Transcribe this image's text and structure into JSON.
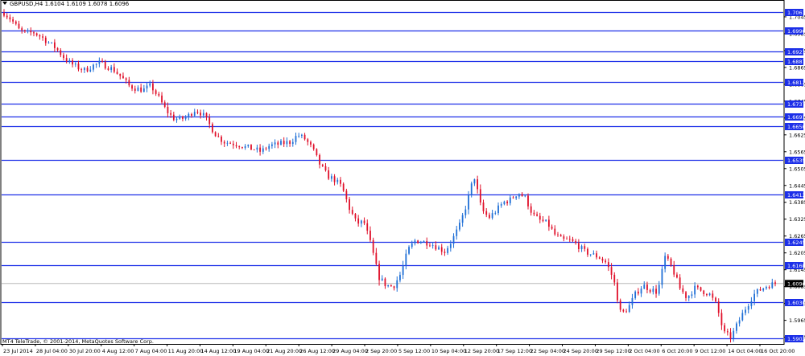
{
  "window": {
    "symbol_line": "GBPUSD,H4  1.6104 1.6109 1.6078 1.6096",
    "copyright": "MT4 TeleTrade, © 2001-2014, MetaQuotes Software Corp."
  },
  "colors": {
    "bull": "#1f6fd6",
    "bear": "#e0102a",
    "level_line": "#1c2fe8",
    "level_label_bg": "#1c2fe8",
    "current_price_line": "#b8b8b8",
    "current_price_bg": "#000000"
  },
  "chart_data": {
    "type": "candlestick",
    "ylim": [
      1.5881,
      1.7102
    ],
    "price_ticks": [
      "1.7045",
      "1.6985",
      "1.6925",
      "1.6865",
      "1.6805",
      "1.6745",
      "1.6685",
      "1.6625",
      "1.6565",
      "1.6505",
      "1.6445",
      "1.6385",
      "1.6325",
      "1.6265",
      "1.6205",
      "1.6145",
      "1.6085",
      "1.6025",
      "1.5965",
      "1.5905"
    ],
    "levels": [
      "1.7061",
      "1.6996",
      "1.6921",
      "1.6887",
      "1.6812",
      "1.6737",
      "1.6691",
      "1.6656",
      "1.6535",
      "1.6412",
      "1.6245",
      "1.6160",
      "1.6030",
      "1.5902"
    ],
    "current_price": "1.6096",
    "date_labels": [
      "23 Jul 2014",
      "28 Jul 04:00",
      "30 Jul 20:00",
      "4 Aug 12:00",
      "7 Aug 04:00",
      "11 Aug 20:00",
      "14 Aug 12:00",
      "19 Aug 04:00",
      "21 Aug 20:00",
      "26 Aug 12:00",
      "29 Aug 04:00",
      "2 Sep 20:00",
      "5 Sep 12:00",
      "10 Sep 04:00",
      "12 Sep 20:00",
      "17 Sep 12:00",
      "22 Sep 04:00",
      "24 Sep 20:00",
      "29 Sep 12:00",
      "2 Oct 04:00",
      "6 Oct 20:00",
      "9 Oct 12:00",
      "14 Oct 04:00",
      "16 Oct 20:00"
    ],
    "path": [
      1.706,
      1.7035,
      1.7,
      1.6985,
      1.699,
      1.6975,
      1.6955,
      1.6935,
      1.6905,
      1.688,
      1.6865,
      1.6855,
      1.687,
      1.688,
      1.687,
      1.6855,
      1.683,
      1.68,
      1.679,
      1.6785,
      1.68,
      1.676,
      1.6715,
      1.6685,
      1.668,
      1.669,
      1.6715,
      1.67,
      1.666,
      1.662,
      1.66,
      1.6595,
      1.659,
      1.658,
      1.6575,
      1.6565,
      1.6585,
      1.659,
      1.6595,
      1.66,
      1.6625,
      1.661,
      1.6575,
      1.652,
      1.648,
      1.6465,
      1.644,
      1.6365,
      1.631,
      1.6315,
      1.623,
      1.612,
      1.609,
      1.6085,
      1.613,
      1.6215,
      1.625,
      1.6245,
      1.624,
      1.6225,
      1.621,
      1.625,
      1.63,
      1.638,
      1.648,
      1.636,
      1.633,
      1.6355,
      1.6385,
      1.6395,
      1.642,
      1.64,
      1.634,
      1.632,
      1.631,
      1.627,
      1.625,
      1.625,
      1.6235,
      1.621,
      1.62,
      1.619,
      1.617,
      1.611,
      1.5985,
      1.601,
      1.606,
      1.609,
      1.6075,
      1.6065,
      1.619,
      1.615,
      1.608,
      1.6045,
      1.608,
      1.607,
      1.606,
      1.602,
      1.592,
      1.5905,
      1.596,
      1.601,
      1.6055,
      1.6075,
      1.609,
      1.6096
    ]
  }
}
